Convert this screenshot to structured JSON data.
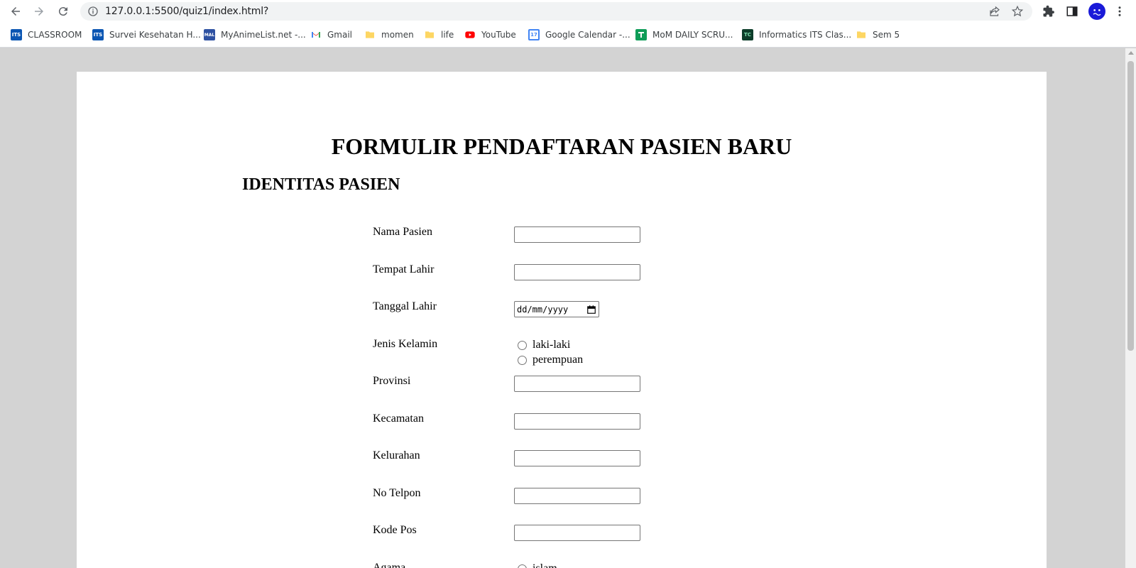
{
  "browser": {
    "url": "127.0.0.1:5500/quiz1/index.html?",
    "bookmarks": [
      {
        "label": "CLASSROOM",
        "icon": "its-icon"
      },
      {
        "label": "Survei Kesehatan H...",
        "icon": "its-icon"
      },
      {
        "label": "MyAnimeList.net -...",
        "icon": "mal-icon"
      },
      {
        "label": "Gmail",
        "icon": "gmail-icon"
      },
      {
        "label": "momen",
        "icon": "folder-icon"
      },
      {
        "label": "life",
        "icon": "folder-icon"
      },
      {
        "label": "YouTube",
        "icon": "youtube-icon"
      },
      {
        "label": "Google Calendar -...",
        "icon": "calendar-icon"
      },
      {
        "label": "MoM DAILY SCRU...",
        "icon": "sheets-icon"
      },
      {
        "label": "Informatics ITS Clas...",
        "icon": "tc-icon"
      },
      {
        "label": "Sem 5",
        "icon": "folder-icon"
      }
    ],
    "icon_badges": {
      "its": "ITS",
      "mal": "MAL",
      "calendar": "17",
      "tc": "TC"
    }
  },
  "page": {
    "title": "FORMULIR PENDAFTARAN PASIEN BARU",
    "section": "IDENTITAS PASIEN",
    "fields": {
      "nama_pasien": "Nama Pasien",
      "tempat_lahir": "Tempat Lahir",
      "tanggal_lahir": "Tanggal Lahir",
      "tanggal_placeholder": "dd/mm/yyyy",
      "jenis_kelamin": "Jenis Kelamin",
      "provinsi": "Provinsi",
      "kecamatan": "Kecamatan",
      "kelurahan": "Kelurahan",
      "no_telpon": "No Telpon",
      "kode_pos": "Kode Pos",
      "agama": "Agama"
    },
    "gender_options": [
      "laki-laki",
      "perempuan"
    ],
    "agama_options": [
      "islam"
    ]
  },
  "colors": {
    "page_background": "#d3d3d3",
    "paper": "#ffffff",
    "avatar": "#1a1ad8"
  }
}
